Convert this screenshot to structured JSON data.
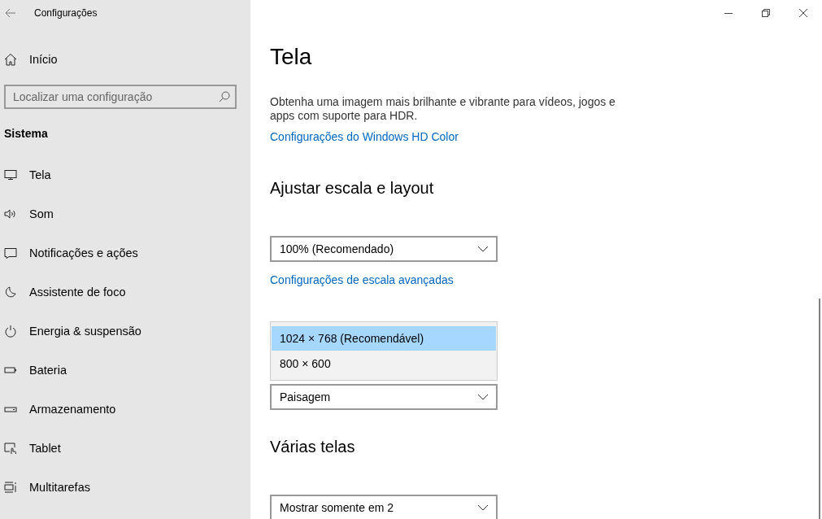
{
  "window": {
    "title": "Configurações"
  },
  "sidebar": {
    "home": "Início",
    "search": {
      "placeholder": "Localizar uma configuração"
    },
    "section": "Sistema",
    "items": [
      {
        "label": "Tela"
      },
      {
        "label": "Som"
      },
      {
        "label": "Notificações e ações"
      },
      {
        "label": "Assistente de foco"
      },
      {
        "label": "Energia & suspensão"
      },
      {
        "label": "Bateria"
      },
      {
        "label": "Armazenamento"
      },
      {
        "label": "Tablet"
      },
      {
        "label": "Multitarefas"
      }
    ]
  },
  "main": {
    "title": "Tela",
    "description": "Obtenha uma imagem mais brilhante e vibrante para vídeos, jogos e apps com suporte para HDR.",
    "hdr_link": "Configurações do Windows HD Color",
    "scale": {
      "heading": "Ajustar escala e layout",
      "value": "100% (Recomendado)",
      "link": "Configurações de escala avançadas"
    },
    "resolution_options": [
      {
        "label": "1024 × 768 (Recomendável)",
        "selected": true
      },
      {
        "label": "800 × 600",
        "selected": false
      }
    ],
    "orientation": {
      "value": "Paisagem"
    },
    "multiple": {
      "heading": "Várias telas",
      "value": "Mostrar somente em 2"
    }
  }
}
